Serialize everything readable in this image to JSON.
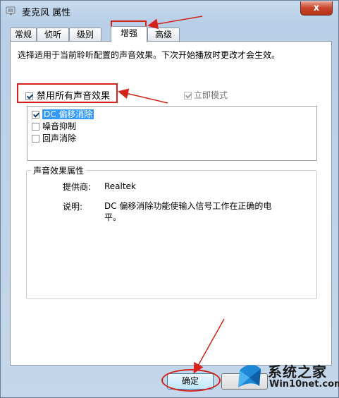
{
  "window": {
    "title": "麦克风 属性",
    "close_glyph": "x"
  },
  "tabs": [
    {
      "label": "常规"
    },
    {
      "label": "侦听"
    },
    {
      "label": "级别"
    },
    {
      "label": "增强"
    },
    {
      "label": "高级"
    }
  ],
  "active_tab": "增强",
  "description": "选择适用于当前聆听配置的声音效果。下次开始播放时更改才会生效。",
  "disable_all": {
    "label": "禁用所有声音效果",
    "checked": true
  },
  "immediate_mode": {
    "label": "立即模式",
    "checked": true,
    "disabled": true
  },
  "effects": [
    {
      "label": "DC 偏移消除",
      "checked": true,
      "selected": true
    },
    {
      "label": "噪音抑制",
      "checked": false,
      "selected": false
    },
    {
      "label": "回声消除",
      "checked": false,
      "selected": false
    }
  ],
  "properties": {
    "group_title": "声音效果属性",
    "provider_label": "提供商:",
    "provider_value": "Realtek",
    "desc_label": "说明:",
    "desc_value": "DC 偏移消除功能使输入信号工作在正确的电平。"
  },
  "buttons": {
    "ok": "确定"
  },
  "watermark": {
    "title": "系统之家",
    "url": "Win10net.com"
  },
  "colors": {
    "annotation": "#d5221b",
    "selection": "#3399ff"
  }
}
